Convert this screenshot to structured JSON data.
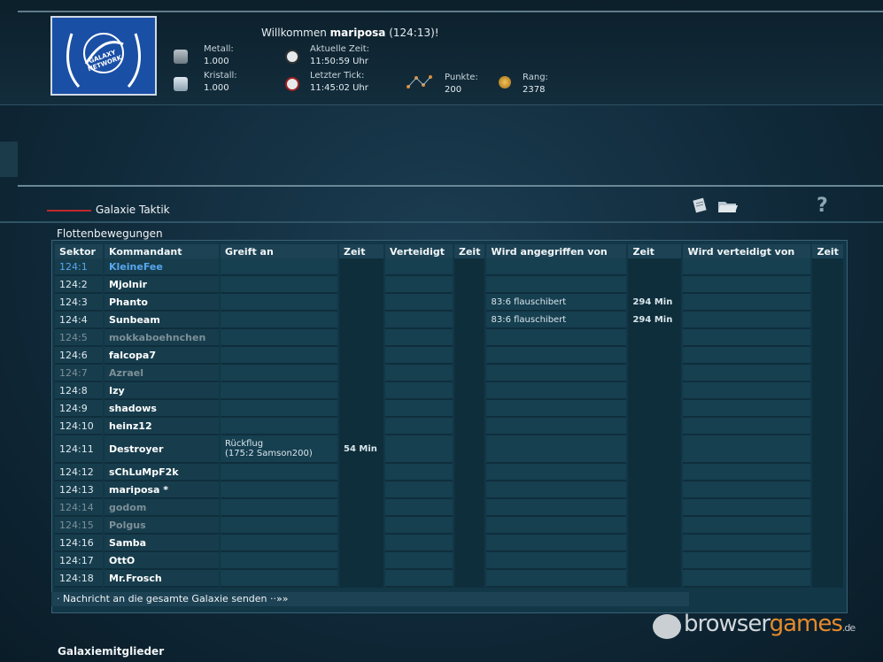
{
  "header": {
    "welcome_prefix": "Willkommen",
    "username": "mariposa",
    "coords": "(124:13)!",
    "logo_line1": "GALAXY",
    "logo_line2": "NETWORK",
    "metal": {
      "label": "Metall:",
      "value": "1.000"
    },
    "crystal": {
      "label": "Kristall:",
      "value": "1.000"
    },
    "current_time": {
      "label": "Aktuelle Zeit:",
      "value": "11:50:59 Uhr"
    },
    "last_tick": {
      "label": "Letzter Tick:",
      "value": "11:45:02 Uhr"
    },
    "points": {
      "label": "Punkte:",
      "value": "200"
    },
    "rank": {
      "label": "Rang:",
      "value": "2378"
    }
  },
  "section_title": "Galaxie Taktik",
  "help_label": "?",
  "fleet": {
    "title": "Flottenbewegungen",
    "columns": [
      "Sektor",
      "Kommandant",
      "Greift an",
      "Zeit",
      "Verteidigt",
      "Zeit",
      "Wird angegriffen von",
      "Zeit",
      "Wird verteidigt von",
      "Zeit"
    ],
    "rows": [
      {
        "sector": "124:1",
        "name": "KleineFee",
        "attacks": "",
        "attacks_time": "",
        "attacked_by": "",
        "attacked_time": "",
        "state": "self"
      },
      {
        "sector": "124:2",
        "name": "Mjolnir",
        "attacks": "",
        "attacks_time": "",
        "attacked_by": "",
        "attacked_time": "",
        "state": "active"
      },
      {
        "sector": "124:3",
        "name": "Phanto",
        "attacks": "",
        "attacks_time": "",
        "attacked_by": "83:6 flauschibert",
        "attacked_time": "294 Min",
        "state": "active"
      },
      {
        "sector": "124:4",
        "name": "Sunbeam",
        "attacks": "",
        "attacks_time": "",
        "attacked_by": "83:6 flauschibert",
        "attacked_time": "294 Min",
        "state": "active"
      },
      {
        "sector": "124:5",
        "name": "mokkaboehnchen",
        "attacks": "",
        "attacks_time": "",
        "attacked_by": "",
        "attacked_time": "",
        "state": "inactive"
      },
      {
        "sector": "124:6",
        "name": "falcopa7",
        "attacks": "",
        "attacks_time": "",
        "attacked_by": "",
        "attacked_time": "",
        "state": "active"
      },
      {
        "sector": "124:7",
        "name": "Azrael",
        "attacks": "",
        "attacks_time": "",
        "attacked_by": "",
        "attacked_time": "",
        "state": "inactive"
      },
      {
        "sector": "124:8",
        "name": "Izy",
        "attacks": "",
        "attacks_time": "",
        "attacked_by": "",
        "attacked_time": "",
        "state": "active"
      },
      {
        "sector": "124:9",
        "name": "shadows",
        "attacks": "",
        "attacks_time": "",
        "attacked_by": "",
        "attacked_time": "",
        "state": "active"
      },
      {
        "sector": "124:10",
        "name": "heinz12",
        "attacks": "",
        "attacks_time": "",
        "attacked_by": "",
        "attacked_time": "",
        "state": "active"
      },
      {
        "sector": "124:11",
        "name": "Destroyer",
        "attacks": "Rückflug\n(175:2 Samson200)",
        "attacks_time": "54 Min",
        "attacked_by": "",
        "attacked_time": "",
        "state": "active"
      },
      {
        "sector": "124:12",
        "name": "sChLuMpF2k",
        "attacks": "",
        "attacks_time": "",
        "attacked_by": "",
        "attacked_time": "",
        "state": "active"
      },
      {
        "sector": "124:13",
        "name": "mariposa *",
        "attacks": "",
        "attacks_time": "",
        "attacked_by": "",
        "attacked_time": "",
        "state": "active"
      },
      {
        "sector": "124:14",
        "name": "godom",
        "attacks": "",
        "attacks_time": "",
        "attacked_by": "",
        "attacked_time": "",
        "state": "inactive"
      },
      {
        "sector": "124:15",
        "name": "Polgus",
        "attacks": "",
        "attacks_time": "",
        "attacked_by": "",
        "attacked_time": "",
        "state": "inactive"
      },
      {
        "sector": "124:16",
        "name": "Samba",
        "attacks": "",
        "attacks_time": "",
        "attacked_by": "",
        "attacked_time": "",
        "state": "active"
      },
      {
        "sector": "124:17",
        "name": "OttO",
        "attacks": "",
        "attacks_time": "",
        "attacked_by": "",
        "attacked_time": "",
        "state": "active"
      },
      {
        "sector": "124:18",
        "name": "Mr.Frosch",
        "attacks": "",
        "attacks_time": "",
        "attacked_by": "",
        "attacked_time": "",
        "state": "active"
      }
    ],
    "footer_link": "Nachricht an die gesamte Galaxie senden ··»»"
  },
  "members_title": "Galaxiemitglieder",
  "watermark": {
    "part1": "browser",
    "part2": "games",
    "tld": ".de"
  },
  "colors": {
    "self_player": "#57a7ee",
    "inactive_player": "#7d8f97",
    "accent_red": "#c0282b"
  }
}
